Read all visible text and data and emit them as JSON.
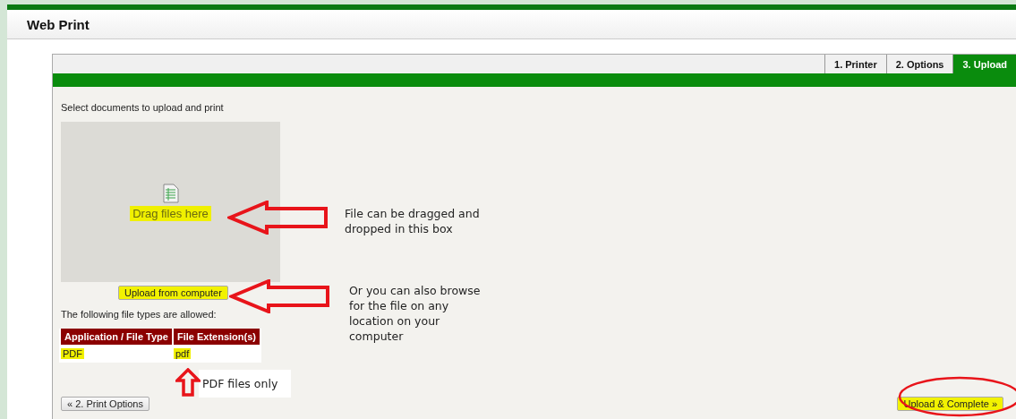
{
  "window": {
    "title": "Web Print"
  },
  "tabs": [
    {
      "label": "1. Printer",
      "selected": false
    },
    {
      "label": "2. Options",
      "selected": false
    },
    {
      "label": "3. Upload",
      "selected": true
    }
  ],
  "upload": {
    "instruction": "Select documents to upload and print",
    "drop_zone": {
      "label": "Drag files here",
      "highlighted": true
    },
    "upload_button": {
      "label": "Upload from computer",
      "highlighted": true
    },
    "allowed_note": "The following file types are allowed:"
  },
  "file_types": {
    "columns": [
      "Application / File Type",
      "File Extension(s)"
    ],
    "rows": [
      [
        {
          "text": "PDF",
          "highlighted": true
        },
        {
          "text": "pdf",
          "highlighted": true
        }
      ]
    ]
  },
  "back_button": {
    "label": "« 2. Print Options"
  },
  "next_button": {
    "label": "Upload & Complete »",
    "highlighted": true,
    "circled": true
  },
  "annotations": [
    {
      "kind": "left-arrow",
      "note": "File can be dragged and dropped in this box"
    },
    {
      "kind": "left-arrow",
      "note": "Or you can also browse for the file on any location on your computer"
    },
    {
      "kind": "up-arrow",
      "note": "PDF files only"
    }
  ]
}
